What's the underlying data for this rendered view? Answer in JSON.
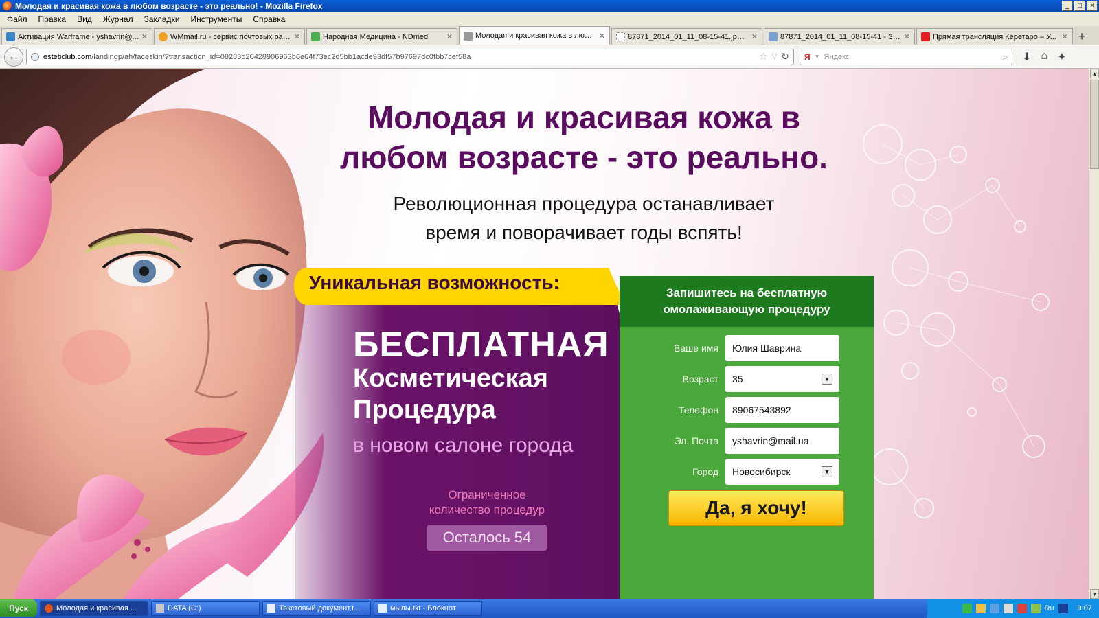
{
  "window": {
    "title": "Молодая и красивая кожа в любом возрасте - это реально! - Mozilla Firefox",
    "controls": [
      "_",
      "□",
      "×"
    ]
  },
  "menu": [
    "Файл",
    "Правка",
    "Вид",
    "Журнал",
    "Закладки",
    "Инструменты",
    "Справка"
  ],
  "tabs": [
    {
      "label": "Активация Warframe - yshavrin@...",
      "active": false,
      "icon_color": "#3a86c8"
    },
    {
      "label": "WMmail.ru - сервис почтовых расс...",
      "active": false,
      "icon_color": "#f0a020"
    },
    {
      "label": "Народная Медицина - NDmed",
      "active": false,
      "icon_color": "#4caf50"
    },
    {
      "label": "Молодая и красивая кожа в любо...",
      "active": true,
      "icon_color": "#999999"
    },
    {
      "label": "87871_2014_01_11_08-15-41.jpg (...",
      "active": false,
      "icon_color": "#bbbbbb"
    },
    {
      "label": "87871_2014_01_11_08-15-41 - За...",
      "active": false,
      "icon_color": "#7aa0d0"
    },
    {
      "label": "Прямая трансляция Керетаро – У...",
      "active": false,
      "icon_color": "#e02020"
    }
  ],
  "address": {
    "host": "esteticlub.com",
    "path": "/landingp/ah/faceskin/?transaction_id=08283d20428906963b6e64f73ec2d5bb1acde93df57b97697dc0fbb7cef58a"
  },
  "search": {
    "placeholder": "Яндекс",
    "engine_letter": "Я"
  },
  "page": {
    "headline_line1": "Молодая и красивая кожа в",
    "headline_line2": "любом возрасте - это реально.",
    "sub_line1": "Революционная процедура останавливает",
    "sub_line2": "время и поворачивает годы вспять!",
    "unique": "Уникальная возможность:",
    "free": "БЕСПЛАТНАЯ",
    "cosm1": "Косметическая",
    "cosm2": "Процедура",
    "salon": "в новом салоне города",
    "limited1": "Ограниченное",
    "limited2": "количество процедур",
    "remaining": "Осталось 54"
  },
  "form": {
    "header1": "Запишитесь на бесплатную",
    "header2": "омолаживающую процедуру",
    "fields": [
      {
        "label": "Ваше имя",
        "value": "Юлия Шаврина",
        "type": "text"
      },
      {
        "label": "Возраст",
        "value": "35",
        "type": "select"
      },
      {
        "label": "Телефон",
        "value": "89067543892",
        "type": "text"
      },
      {
        "label": "Эл. Почта",
        "value": "yshavrin@mail.ua",
        "type": "text"
      },
      {
        "label": "Город",
        "value": "Новосибирск",
        "type": "select"
      }
    ],
    "submit": "Да, я хочу!"
  },
  "taskbar": {
    "start": "Пуск",
    "tasks": [
      {
        "label": "Молодая и красивая ...",
        "active": true
      },
      {
        "label": "DATA (C:)",
        "active": false
      },
      {
        "label": "Текстовый документ.t...",
        "active": false
      },
      {
        "label": "мылы.txt - Блокнот",
        "active": false
      }
    ],
    "lang": "Ru",
    "time": "9:07"
  },
  "colors": {
    "headline": "#5a0c5e",
    "offer_purple": "#5c0f5f",
    "banner_yellow": "#ffd400",
    "form_green": "#4aa83d",
    "form_header_green": "#1e7a1f"
  }
}
